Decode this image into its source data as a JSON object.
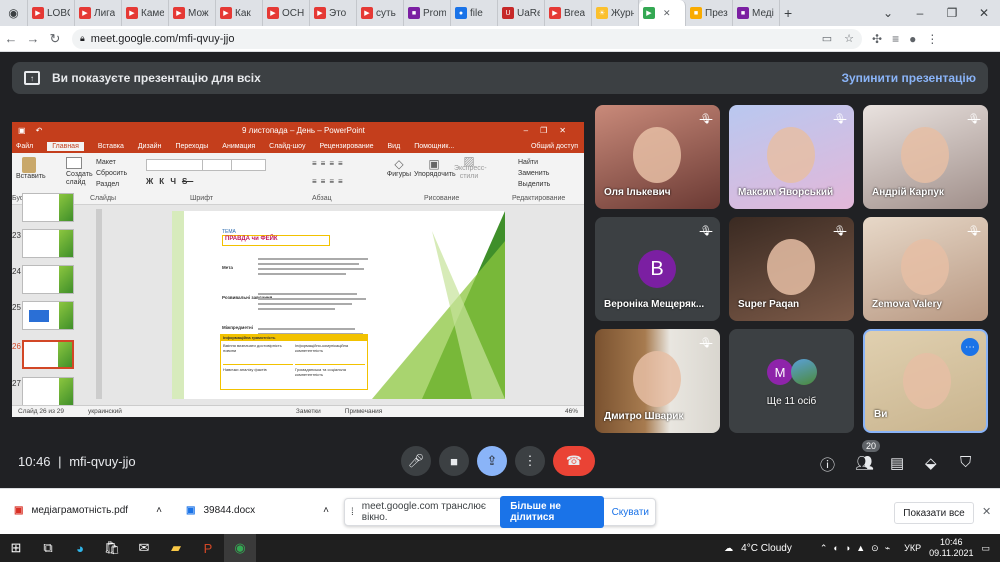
{
  "browser": {
    "tabs": [
      {
        "label": "LOBO",
        "color": "#e53935",
        "glyph": "▶"
      },
      {
        "label": "Лига",
        "color": "#e53935",
        "glyph": "▶"
      },
      {
        "label": "Каме",
        "color": "#e53935",
        "glyph": "▶"
      },
      {
        "label": "Мож",
        "color": "#e53935",
        "glyph": "▶"
      },
      {
        "label": "Как",
        "color": "#e53935",
        "glyph": "▶"
      },
      {
        "label": "ОСН",
        "color": "#e53935",
        "glyph": "▶"
      },
      {
        "label": "Это",
        "color": "#e53935",
        "glyph": "▶"
      },
      {
        "label": "суть",
        "color": "#e53935",
        "glyph": "▶"
      },
      {
        "label": "Prom",
        "color": "#7b1fa2",
        "glyph": "■"
      },
      {
        "label": "file",
        "color": "#1a73e8",
        "glyph": "●"
      },
      {
        "label": "UaRe",
        "color": "#c62828",
        "glyph": "U"
      },
      {
        "label": "Brea",
        "color": "#e53935",
        "glyph": "▶"
      },
      {
        "label": "Журн",
        "color": "#fbc02d",
        "glyph": "☀"
      },
      {
        "label": "",
        "color": "#34a853",
        "glyph": "▶"
      },
      {
        "label": "През",
        "color": "#f9ab00",
        "glyph": "■"
      },
      {
        "label": "Меді",
        "color": "#7b1fa2",
        "glyph": "■"
      }
    ],
    "new_tab": "+",
    "url": "meet.google.com/mfi-qvuy-jjo"
  },
  "banner": {
    "text": "Ви показуєте презентацію для всіх",
    "stop": "Зупинити презентацію"
  },
  "ppt": {
    "title": "9 листопада – День – PowerPoint",
    "tabs": [
      "Файл",
      "Главная",
      "Вставка",
      "Дизайн",
      "Переходы",
      "Анимация",
      "Слайд-шоу",
      "Рецензирование",
      "Вид",
      "Помощник..."
    ],
    "share": "Общий доступ",
    "ribbon": {
      "paste": "Вставить",
      "create_slide": "Создать слайд",
      "layout": "Макет",
      "reset": "Сбросить",
      "section": "Раздел",
      "groups": [
        "Буфер обме...",
        "Слайды",
        "Шрифт",
        "Абзац",
        "Рисование",
        "Редактирование"
      ],
      "shapes": "Фигуры",
      "arrange": "Упорядочить",
      "styles": "Экспресс-стили",
      "find": "Найти",
      "replace": "Заменить",
      "select": "Выделить"
    },
    "thumb_numbers": [
      "23",
      "24",
      "25",
      "26",
      "27"
    ],
    "slide": {
      "topic": "ТЕМА",
      "title": "ПРАВДА чи ФЕЙК",
      "rows": [
        "Мета",
        "Розвивальні завдання",
        "Міжпредметні"
      ],
      "table_head": "Інформаційна грамотність",
      "table_cells": [
        "Вміння визначати достовірність новини",
        "Інформаційно-комунікаційна компетентність",
        "Навички аналізу фактів",
        "Громадянська та соціальна компетентність"
      ]
    },
    "status": {
      "slide": "Слайд 26 из 29",
      "lang": "украинский",
      "notes": "Заметки",
      "comments": "Примечания",
      "zoom": "46%"
    }
  },
  "participants": [
    {
      "name": "Оля Ількевич",
      "muted": true
    },
    {
      "name": "Максим Яворський",
      "muted": true
    },
    {
      "name": "Андрій Карпук",
      "muted": true
    },
    {
      "name": "Вероніка Мещеряк...",
      "muted": true,
      "initial": "B"
    },
    {
      "name": "Super Paqan",
      "muted": true
    },
    {
      "name": "Zemova Valery",
      "muted": true
    },
    {
      "name": "Дмитро Шварик",
      "muted": true
    },
    {
      "name": "Ще 11 осіб",
      "muted": false,
      "initial": "M"
    },
    {
      "name": "Ви",
      "muted": false
    }
  ],
  "controls": {
    "time": "10:46",
    "separator": "|",
    "code": "mfi-qvuy-jjo",
    "people_count": "20"
  },
  "downloads": {
    "items": [
      "медіаграмотність.pdf",
      "39844.docx"
    ],
    "share_text": "meet.google.com транслює вікно.",
    "stop_sharing": "Більше не ділитися",
    "cancel": "Скувати",
    "show_all": "Показати все"
  },
  "taskbar": {
    "weather": "4°C  Cloudy",
    "lang": "УКР",
    "time": "10:46",
    "date": "09.11.2021"
  }
}
